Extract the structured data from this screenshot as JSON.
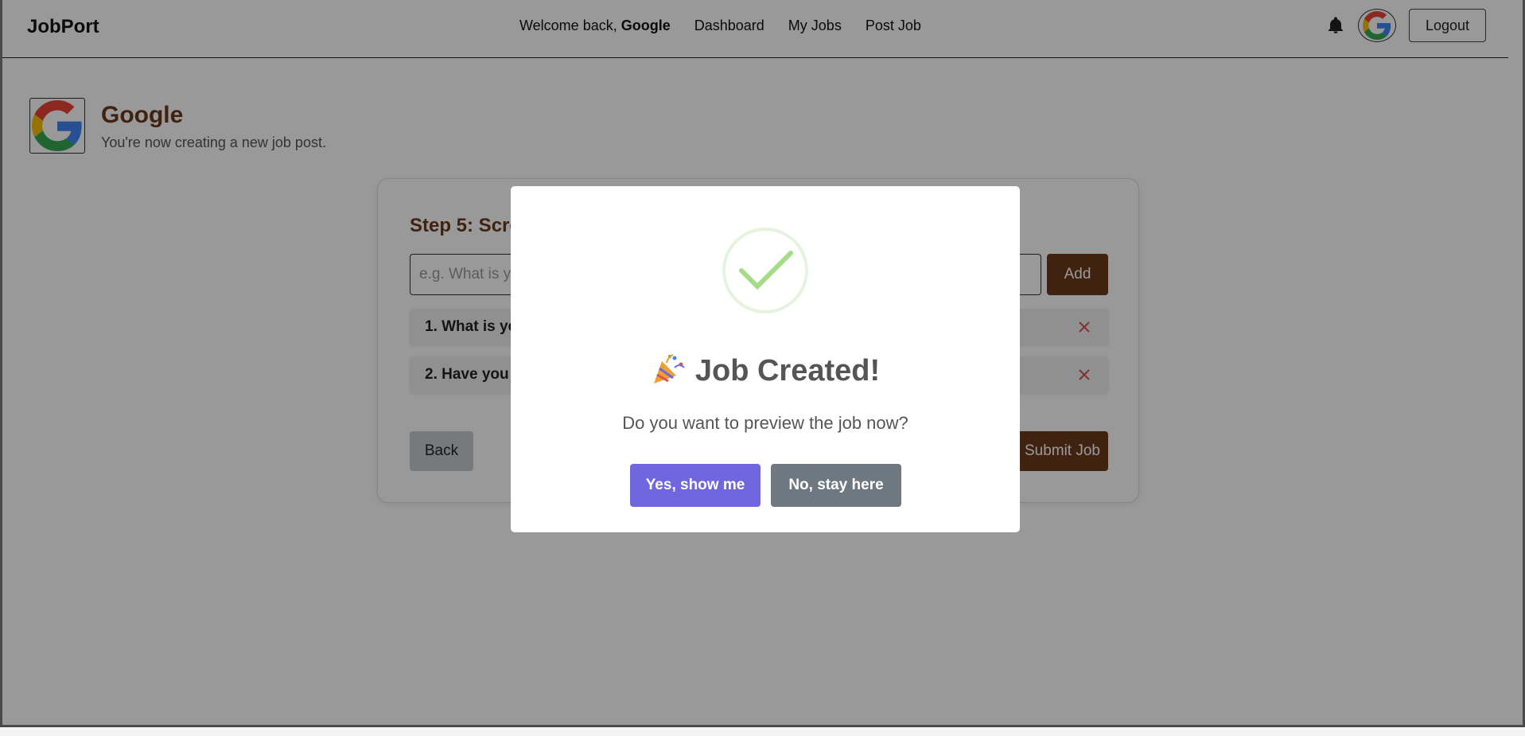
{
  "navbar": {
    "brand": "JobPort",
    "welcome_prefix": "Welcome back,",
    "welcome_user": "Google",
    "links": [
      "Dashboard",
      "My Jobs",
      "Post Job"
    ],
    "bell_icon": "bell-icon",
    "avatar_icon": "google-logo-icon",
    "logout_label": "Logout"
  },
  "header": {
    "company_name": "Google",
    "subtitle": "You're now creating a new job post."
  },
  "form": {
    "step_title": "Step 5: Screening Questions",
    "input_placeholder": "e.g. What is your experience with this role?",
    "input_value": "",
    "add_label": "Add",
    "questions": [
      "1. What is your",
      "2. Have you"
    ],
    "remove_icon": "close-icon",
    "back_label": "Back",
    "submit_label": "Submit Job"
  },
  "modal": {
    "icon": "success-check-icon",
    "emoji": "party-popper",
    "title": "Job Created!",
    "text": "Do you want to preview the job now?",
    "confirm_label": "Yes, show me",
    "cancel_label": "No, stay here"
  },
  "colors": {
    "brown": "#6b3a1d",
    "confirm": "#7066e0",
    "cancel": "#6e7881",
    "remove": "#d9534f",
    "success": "#a5dc86"
  }
}
